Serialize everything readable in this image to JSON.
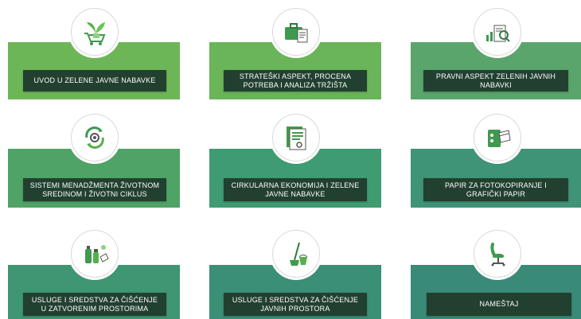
{
  "cards": [
    {
      "label": "UVOD U ZELENE JAVNE NABAVKE",
      "icon": "shopping-cart-plant-icon"
    },
    {
      "label": "STRATEŠKI ASPEKT, PROCENA POTREBA I ANALIZA TRŽIŠTA",
      "icon": "briefcase-documents-icon"
    },
    {
      "label": "PRAVNI ASPEKT ZELENIH JAVNIH NABAVKI",
      "icon": "documents-magnifier-chart-icon"
    },
    {
      "label": "SISTEMI MENADŽMENTA ŽIVOTNOM SREDINOM I ŽIVOTNI CIKLUS",
      "icon": "recycle-gear-icon"
    },
    {
      "label": "CIRKULARNA EKONOMIJA I ZELENE JAVNE NABAVKE",
      "icon": "circular-economy-document-icon"
    },
    {
      "label": "PAPIR ZA FOTOKOPIRANJE I GRAFIČKI PAPIR",
      "icon": "photocopier-paper-icon"
    },
    {
      "label": "USLUGE I SREDSTVA ZA ČIŠĆENJE U ZATVORENIM PROSTORIMA",
      "icon": "cleaning-products-icon"
    },
    {
      "label": "USLUGE I SREDSTVA ZA ČIŠĆENJE JAVNIH PROSTORA",
      "icon": "broom-bucket-icon"
    },
    {
      "label": "NAMEŠTAJ",
      "icon": "office-chair-icon"
    }
  ],
  "colors": {
    "card_row1": [
      "#6db657",
      "#6ab459",
      "#5aa56c"
    ],
    "card_row2": [
      "#4fa366",
      "#3f9b72",
      "#3f9376"
    ],
    "card_row3": [
      "#3e9673",
      "#3a8f76",
      "#3a8a78"
    ],
    "label_bg": "#22402f",
    "icon_green": "#3f9a4f"
  }
}
